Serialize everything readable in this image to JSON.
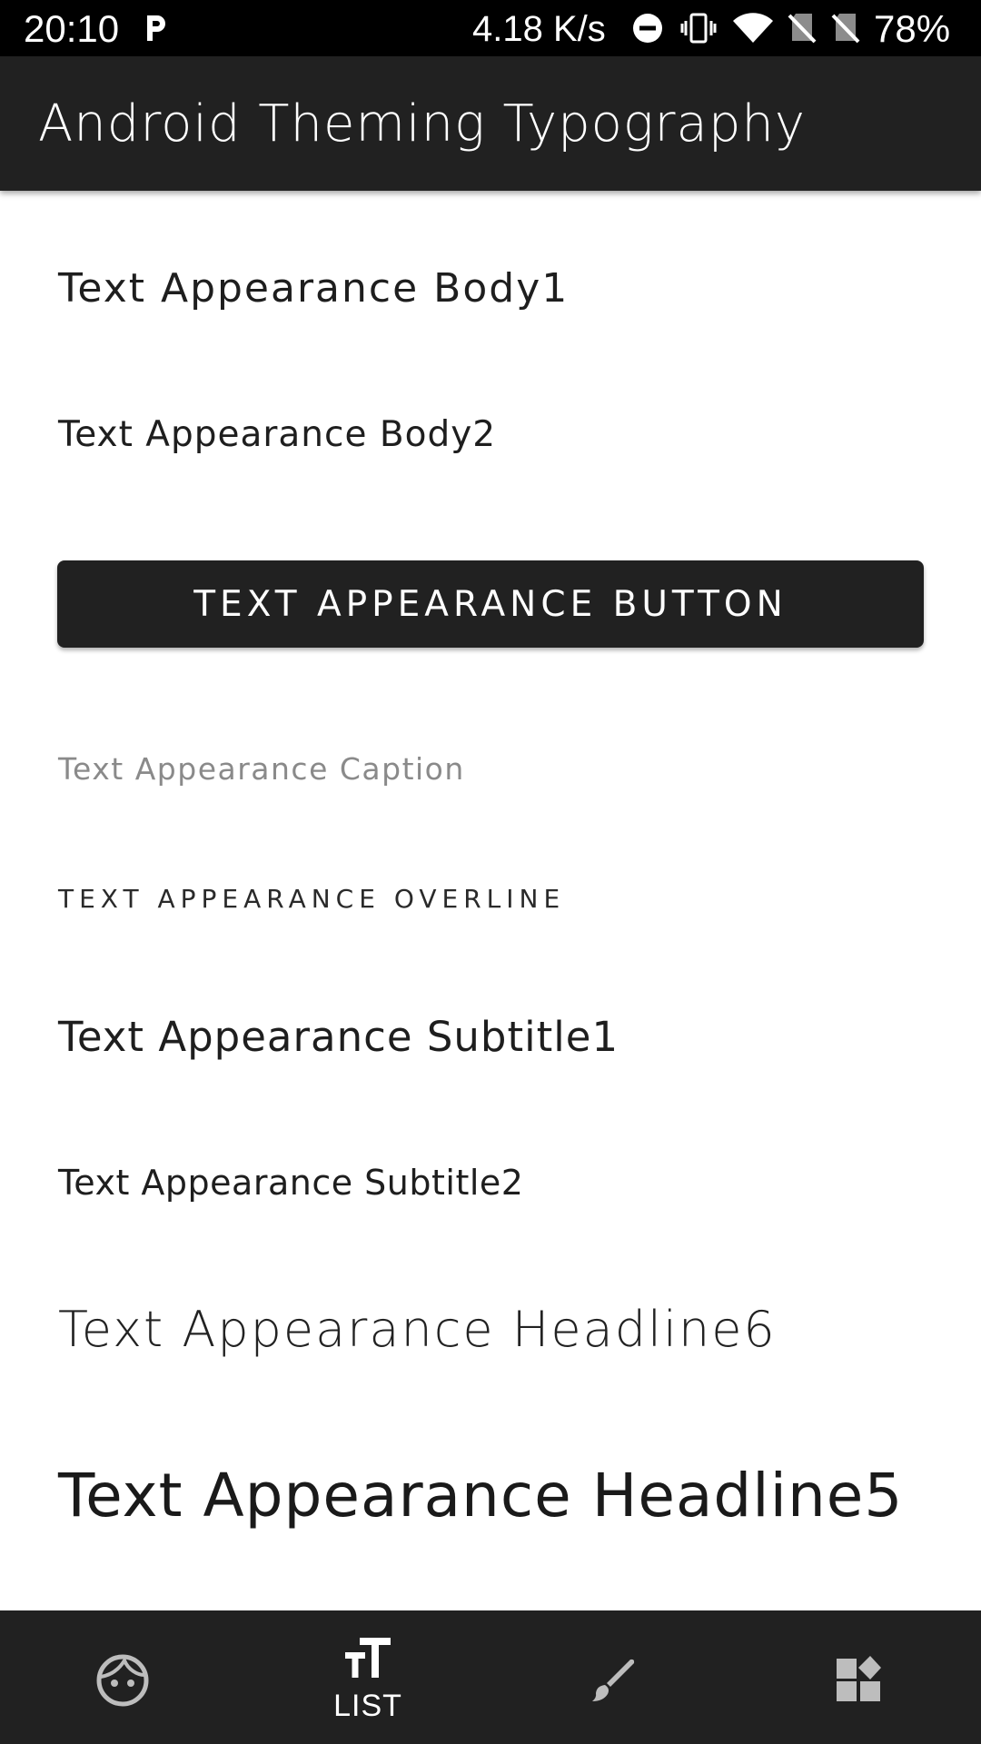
{
  "status_bar": {
    "time": "20:10",
    "network_speed": "4.18 K/s",
    "battery": "78%",
    "icons": [
      "parking-p-icon",
      "do-not-disturb-icon",
      "vibrate-icon",
      "wifi-icon",
      "no-sim-icon",
      "no-sim-icon",
      "battery-icon"
    ]
  },
  "app_bar": {
    "title": "Android Theming Typography"
  },
  "content": {
    "body1": "Text Appearance Body1",
    "body2": "Text Appearance Body2",
    "button": "TEXT APPEARANCE BUTTON",
    "caption": "Text Appearance Caption",
    "overline": "TEXT APPEARANCE OVERLINE",
    "subtitle1": "Text Appearance Subtitle1",
    "subtitle2": "Text Appearance Subtitle2",
    "headline6": "Text Appearance Headline6",
    "headline5": "Text Appearance Headline5"
  },
  "bottom_nav": {
    "items": [
      {
        "icon": "face-icon",
        "label": ""
      },
      {
        "icon": "text-fields-icon",
        "label": "LIST",
        "selected": true
      },
      {
        "icon": "brush-icon",
        "label": ""
      },
      {
        "icon": "widgets-icon",
        "label": ""
      }
    ]
  },
  "colors": {
    "app_bar": "#212121",
    "button": "#212121",
    "bottom_nav": "#212121",
    "caption": "#8a8a8a",
    "background": "#ffffff"
  }
}
